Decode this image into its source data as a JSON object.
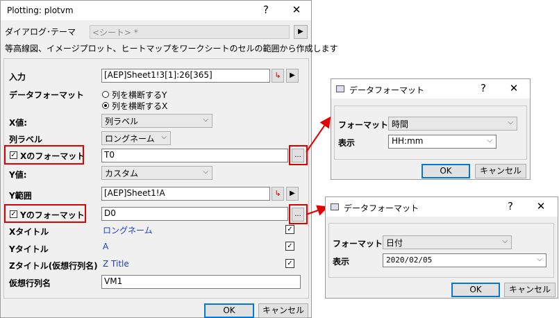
{
  "main": {
    "title": "Plotting: plotvm",
    "help": "?",
    "close": "✕",
    "theme_label": "ダイアログ･テーマ",
    "theme_value": "<シート> *",
    "description": "等高線図、イメージプロット、ヒートマップをワークシートのセルの範囲から作成します",
    "input_label": "入力",
    "input_value": "[AEP]Sheet1!3[1]:26[365]",
    "data_format_label": "データフォーマット",
    "radio1": "列を横断するY",
    "radio2": "列を横断するX",
    "xval_label": "X値:",
    "xval_value": "列ラベル",
    "collabel_label": "列ラベル",
    "collabel_value": "ロングネーム",
    "xformat_label": "Xのフォーマット",
    "xformat_value": "T0",
    "yval_label": "Y値:",
    "yval_value": "カスタム",
    "yrange_label": "Y範囲",
    "yrange_value": "[AEP]Sheet1!A",
    "yformat_label": "Yのフォーマット",
    "yformat_value": "D0",
    "xtitle_label": "Xタイトル",
    "xtitle_value": "ロングネーム",
    "ytitle_label": "Yタイトル",
    "ytitle_value": "A",
    "ztitle_label": "Zタイトル(仮想行列名)",
    "ztitle_value": "Z Title",
    "vm_label": "仮想行列名",
    "vm_value": "VM1",
    "ok": "OK",
    "cancel": "キャンセル",
    "ellipsis": "...",
    "play": "▶"
  },
  "dialog1": {
    "title": "データフォーマット",
    "help": "?",
    "close": "✕",
    "format_label": "フォーマット",
    "format_value": "時間",
    "display_label": "表示",
    "display_value": "HH:mm",
    "ok": "OK",
    "cancel": "キャンセル"
  },
  "dialog2": {
    "title": "データフォーマット",
    "help": "?",
    "close": "✕",
    "format_label": "フォーマット",
    "format_value": "日付",
    "display_label": "表示",
    "display_value": "2020/02/05",
    "ok": "OK",
    "cancel": "キャンセル"
  },
  "colors": {
    "highlight": "#e00000",
    "link": "#1a3fd0",
    "accent": "#0078d7"
  }
}
